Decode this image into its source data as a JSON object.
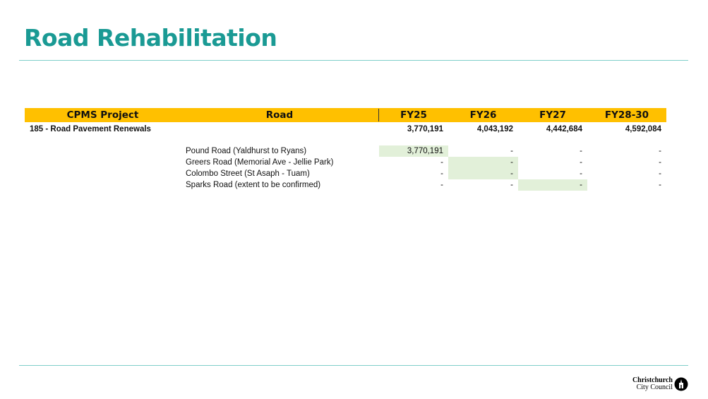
{
  "title": "Road Rehabilitation",
  "table": {
    "headers": [
      "CPMS Project",
      "Road",
      "FY25",
      "FY26",
      "FY27",
      "FY28-30"
    ],
    "project": {
      "name": "185 - Road Pavement Renewals",
      "totals": [
        "3,770,191",
        "4,043,192",
        "4,442,684",
        "4,592,084"
      ]
    },
    "rows": [
      {
        "road": "Pound Road (Yaldhurst to Ryans)",
        "values": [
          "3,770,191",
          "-",
          "-",
          "-"
        ]
      },
      {
        "road": "Greers Road (Memorial Ave - Jellie Park)",
        "values": [
          "-",
          "-",
          "-",
          "-"
        ]
      },
      {
        "road": "Colombo Street (St Asaph - Tuam)",
        "values": [
          "-",
          "-",
          "-",
          "-"
        ]
      },
      {
        "road": "Sparks Road (extent to be confirmed)",
        "values": [
          "-",
          "-",
          "-",
          "-"
        ]
      }
    ],
    "highlight_color": "#e2f0d9",
    "header_color": "#ffc000"
  },
  "logo": {
    "line1": "Christchurch",
    "line2": "City Council",
    "icon": "cathedral-icon"
  },
  "colors": {
    "title": "#1a9a94",
    "rule": "#7fcfca"
  }
}
